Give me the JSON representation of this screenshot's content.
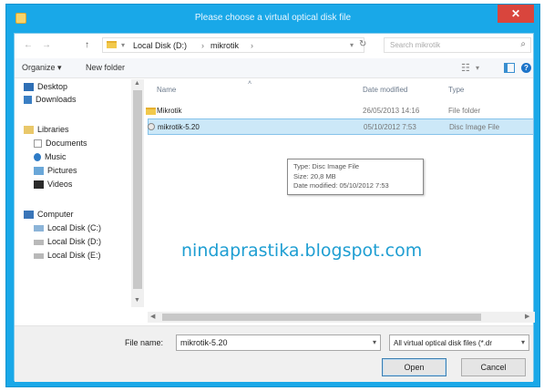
{
  "dialog": {
    "title": "Please choose a virtual optical disk file",
    "close_glyph": "✕"
  },
  "address_bar": {
    "back_glyph": "←",
    "forward_glyph": "→",
    "up_glyph": "↑",
    "crumbs": [
      "Local Disk (D:)",
      "mikrotik"
    ],
    "separator": "›",
    "refresh_glyph": "↻",
    "search_placeholder": "Search mikrotik",
    "search_glyph": "⌕"
  },
  "toolbar": {
    "organize_label": "Organize ▾",
    "new_folder_label": "New folder",
    "help_glyph": "?"
  },
  "nav_pane": {
    "favorites": [
      {
        "label": "Desktop",
        "icon": "desktop-icon"
      },
      {
        "label": "Downloads",
        "icon": "downloads-icon"
      }
    ],
    "libraries_label": "Libraries",
    "libraries": [
      {
        "label": "Documents",
        "icon": "documents-icon"
      },
      {
        "label": "Music",
        "icon": "music-icon"
      },
      {
        "label": "Pictures",
        "icon": "pictures-icon"
      },
      {
        "label": "Videos",
        "icon": "videos-icon"
      }
    ],
    "computer_label": "Computer",
    "drives": [
      {
        "label": "Local Disk (C:)",
        "icon": "drive-icon"
      },
      {
        "label": "Local Disk (D:)",
        "icon": "drive-icon"
      },
      {
        "label": "Local Disk (E:)",
        "icon": "drive-icon"
      }
    ]
  },
  "file_list": {
    "columns": {
      "name": "Name",
      "date": "Date modified",
      "type": "Type"
    },
    "rows": [
      {
        "name": "Mikrotik",
        "date": "26/05/2013 14:16",
        "type": "File folder",
        "icon": "folder-icon",
        "selected": false
      },
      {
        "name": "mikrotik-5.20",
        "date": "05/10/2012 7:53",
        "type": "Disc Image File",
        "icon": "disc-image-icon",
        "selected": true
      }
    ],
    "tooltip": {
      "type_line": "Type: Disc Image File",
      "size_line": "Size: 20,8 MB",
      "date_line": "Date modified: 05/10/2012 7:53"
    }
  },
  "watermark": "nindaprastika.blogspot.com",
  "bottom": {
    "file_name_label": "File name:",
    "file_name_value": "mikrotik-5.20",
    "filter_value": "All virtual optical disk files (*.dr",
    "open_label": "Open",
    "cancel_label": "Cancel"
  },
  "colors": {
    "accent": "#19a8e8",
    "close": "#d9453d",
    "selection": "#cce8f8"
  }
}
